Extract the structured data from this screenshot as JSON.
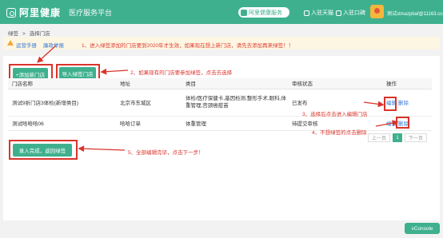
{
  "header": {
    "brand": "阿里健康",
    "subbrand": "医疗服务平台",
    "pill_label": "阿里健康服务",
    "nav": [
      "入驻天猫",
      "入驻口碑"
    ],
    "user": "测试stmazpbaf@11163.com"
  },
  "breadcrumb": [
    "绿签",
    ">",
    "选择门店"
  ],
  "tip": {
    "links": [
      "运营手册",
      "廉政举报"
    ],
    "message": "1、进入绿签添加的门店要到2020年才生效，如果现在想上新门店，请先去添加再来绿签！！"
  },
  "toolbar": {
    "add_store": "+添加新门店",
    "import_store": "导入绿签门店",
    "done": "录入完成，返回绿签"
  },
  "table": {
    "headers": [
      "门店名称",
      "地址",
      "类目",
      "审核状态",
      "操作"
    ],
    "rows": [
      {
        "name": "测试9折门店3体检(新增类目)",
        "address": "北京市东城区",
        "category": "体检/医疗保健卡,基因检测,整形手术,眼科,体重管理,宫颈癌疫苗",
        "status": "已发布",
        "edit": "编辑",
        "delete": "删除"
      },
      {
        "name": "测试哈哈哈06",
        "address": "哈哈订单",
        "category": "体重管理",
        "status": "待提交审核",
        "edit": "编辑",
        "delete": "删除"
      }
    ]
  },
  "pager": {
    "prev": "上一页",
    "current": "1",
    "next": "下一页"
  },
  "annotations": {
    "step2": "2、如果现有的门店要参加绿签，点击去选择",
    "step3": "3、选择后点击进入编辑门店",
    "step4": "4、不想绿签的点击删除",
    "step5": "5、全部编辑完毕，点击下一步！"
  },
  "vconsole": "vConsole",
  "colors": {
    "brand": "#3fb08e",
    "annotation": "#d9342b",
    "link": "#3a7bd5",
    "warning": "#f0a93b"
  }
}
